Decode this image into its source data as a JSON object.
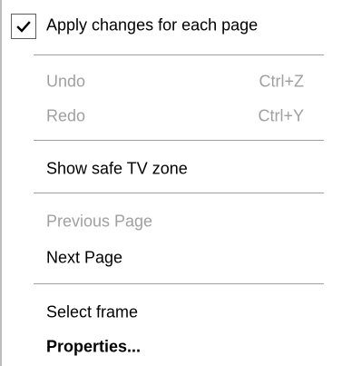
{
  "menu": {
    "apply_changes": {
      "label": "Apply changes for each page",
      "checked": true
    },
    "undo": {
      "label": "Undo",
      "shortcut": "Ctrl+Z",
      "enabled": false
    },
    "redo": {
      "label": "Redo",
      "shortcut": "Ctrl+Y",
      "enabled": false
    },
    "safe_tv_zone": {
      "label": "Show safe TV zone"
    },
    "previous_page": {
      "label": "Previous Page",
      "enabled": false
    },
    "next_page": {
      "label": "Next Page"
    },
    "select_frame": {
      "label": "Select frame"
    },
    "properties": {
      "label": "Properties..."
    }
  },
  "colors": {
    "disabled_text": "#a0a0a0",
    "separator": "#a0a0a0",
    "checkbox_border": "#5e5e5e",
    "left_border": "#bdbdbd"
  },
  "icons": {
    "check": "checkmark-icon"
  }
}
